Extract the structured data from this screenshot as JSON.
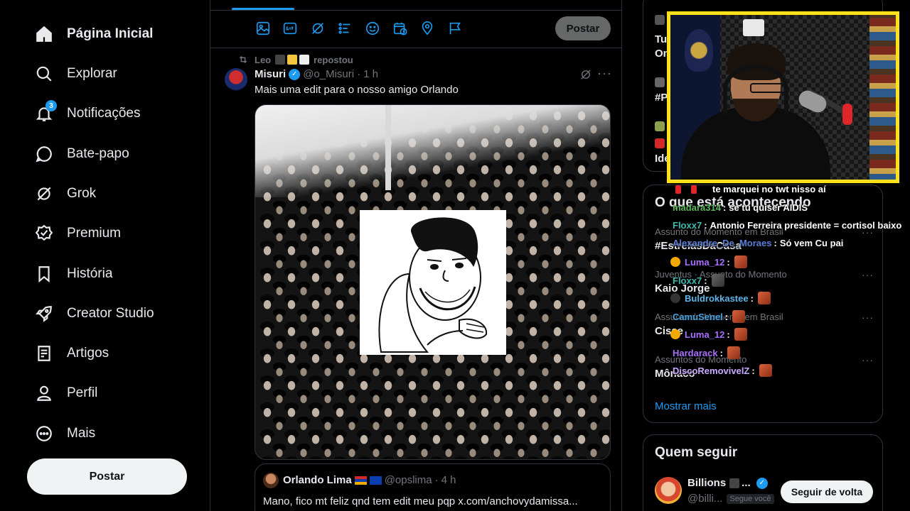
{
  "sidebar": {
    "items": [
      {
        "label": "Página Inicial",
        "icon": "home-icon",
        "active": true
      },
      {
        "label": "Explorar",
        "icon": "search-icon"
      },
      {
        "label": "Notificações",
        "icon": "bell-icon",
        "badge": "3"
      },
      {
        "label": "Bate-papo",
        "icon": "chat-bubble-icon"
      },
      {
        "label": "Grok",
        "icon": "grok-icon"
      },
      {
        "label": "Premium",
        "icon": "premium-badge-icon"
      },
      {
        "label": "História",
        "icon": "bookmark-icon"
      },
      {
        "label": "Creator Studio",
        "icon": "rocket-icon"
      },
      {
        "label": "Artigos",
        "icon": "article-icon"
      },
      {
        "label": "Perfil",
        "icon": "person-icon"
      },
      {
        "label": "Mais",
        "icon": "more-circle-icon"
      }
    ],
    "post_label": "Postar"
  },
  "compose": {
    "post_label": "Postar",
    "tools": [
      "image-icon",
      "gif-icon",
      "grok-icon",
      "poll-icon",
      "emoji-icon",
      "schedule-icon",
      "location-icon",
      "flag-icon"
    ]
  },
  "tweet": {
    "repost_user": "Leo",
    "repost_label": "repostou",
    "name": "Misuri",
    "handle": "@o_Misuri",
    "time": "1 h",
    "text": "Mais uma edit para o nosso amigo Orlando",
    "quote": {
      "name": "Orlando Lima",
      "handle": "@opslima",
      "time": "4 h",
      "text": "Mano, fico mt feliz qnd tem edit meu pqp x.com/anchovydamissa..."
    }
  },
  "right": {
    "top_card": {
      "line1": "Tu",
      "line2": "On",
      "line3": "#P",
      "line4": "Ide"
    },
    "trends_title": "O que está acontecendo",
    "trends": [
      {
        "meta": "Assunto do Momento em Brasil",
        "name": "#EstrelasDaCasa"
      },
      {
        "meta": "Juventus · Assunto do Momento",
        "name": "Kaio Jorge"
      },
      {
        "meta": "Assunto do Momento em Brasil",
        "name": "Cisse"
      },
      {
        "meta": "Assuntos do Momento",
        "name": "Mônaco"
      }
    ],
    "show_more": "Mostrar mais",
    "who_title": "Quem seguir",
    "who": {
      "name": "Billions",
      "name_suffix": "...",
      "handle": "@billi...",
      "follows_you": "Segue você",
      "follow_label": "Seguir de volta"
    }
  },
  "chat": [
    {
      "user": "",
      "text": "te marquei no twt nisso aí",
      "color": "#ffffff"
    },
    {
      "user": "madara314",
      "text": "se tu quiser AIDIS",
      "color": "#5cb85c"
    },
    {
      "user": "Floxx7",
      "text": "Antonio Ferreira presidente = cortisol baixo",
      "color": "#3fb8af"
    },
    {
      "user": "Alexandre_De_Moraes",
      "text": "Só vem Cu pai",
      "color": "#5b7fd6"
    },
    {
      "user": "Luma_12",
      "text": "",
      "color": "#a970ff"
    },
    {
      "user": "Floxx7",
      "text": "",
      "color": "#3fb8af"
    },
    {
      "user": "Buldrokkastee",
      "text": "",
      "color": "#5fb4e8"
    },
    {
      "user": "CamuSenel",
      "text": "",
      "color": "#4aa3df"
    },
    {
      "user": "Luma_12",
      "text": "",
      "color": "#a970ff"
    },
    {
      "user": "Hardarack",
      "text": "",
      "color": "#a970ff"
    },
    {
      "user": "DiscoRemovivelZ",
      "text": "",
      "color": "#c9a9ff"
    }
  ],
  "colors": {
    "accent": "#1d9bf0",
    "webcam_border": "#ffe11a",
    "background": "#000000",
    "text": "#e7e9ea",
    "muted": "#71767b"
  }
}
